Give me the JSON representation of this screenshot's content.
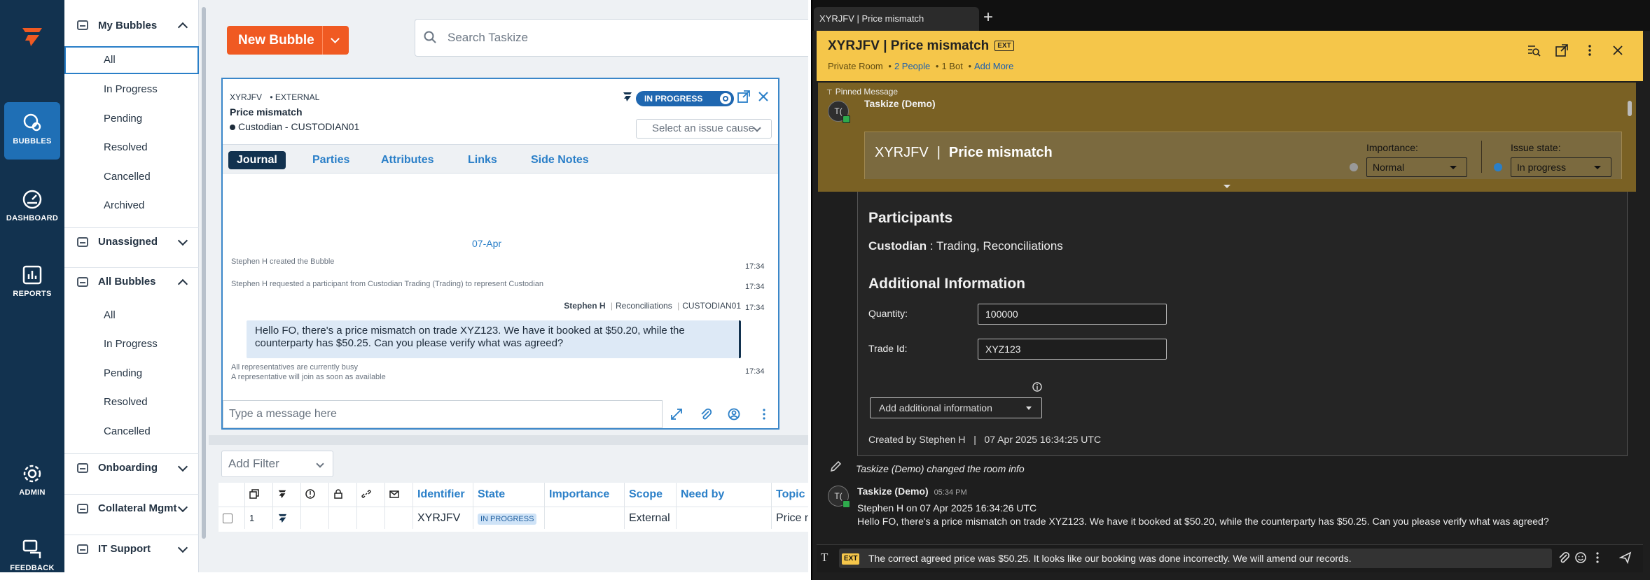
{
  "rail": {
    "items": [
      {
        "label": "BUBBLES"
      },
      {
        "label": "DASHBOARD"
      },
      {
        "label": "REPORTS"
      },
      {
        "label": "ADMIN"
      },
      {
        "label": "FEEDBACK"
      }
    ]
  },
  "sidebar": {
    "groups": [
      {
        "label": "My Bubbles",
        "items": [
          "All",
          "In Progress",
          "Pending",
          "Resolved",
          "Cancelled",
          "Archived"
        ]
      },
      {
        "label": "Unassigned"
      },
      {
        "label": "All Bubbles",
        "items": [
          "All",
          "In Progress",
          "Pending",
          "Resolved",
          "Cancelled"
        ]
      },
      {
        "label": "Onboarding"
      },
      {
        "label": "Collateral Mgmt"
      },
      {
        "label": "IT Support"
      }
    ]
  },
  "toolbar": {
    "new_bubble": "New Bubble",
    "search_placeholder": "Search Taskize"
  },
  "bubble": {
    "id": "XYRJFV",
    "scope": "• EXTERNAL",
    "title": "Price mismatch",
    "party": "Custodian - CUSTODIAN01",
    "status": "IN PROGRESS",
    "issue_cause_placeholder": "Select an issue cause",
    "tabs": [
      "Journal",
      "Parties",
      "Attributes",
      "Links",
      "Side Notes"
    ],
    "journal": {
      "date": "07-Apr",
      "events": [
        {
          "text": "Stephen H created the Bubble",
          "time": "17:34"
        },
        {
          "text": "Stephen H requested a participant from Custodian Trading (Trading) to represent Custodian",
          "time": "17:34"
        }
      ],
      "message_author": "Stephen H",
      "message_team": "Reconciliations",
      "message_org": "CUSTODIAN01",
      "message_time": "17:34",
      "message_text": "Hello FO, there's a price mismatch on trade XYZ123. We have it booked at $50.20, while the counterparty has $50.25. Can you please verify what was agreed?",
      "busy_line1": "All representatives are currently busy",
      "busy_line2": "A representative will join as soon as available",
      "busy_time": "17:34"
    },
    "composer_placeholder": "Type a message here"
  },
  "list": {
    "add_filter": "Add Filter",
    "columns": [
      "Identifier",
      "State",
      "Importance",
      "Scope",
      "Need by",
      "Topic"
    ],
    "rows": [
      {
        "num": "1",
        "identifier": "XYRJFV",
        "state": "IN PROGRESS",
        "importance": "",
        "scope": "External",
        "need_by": "",
        "topic": "Price m"
      }
    ]
  },
  "chat": {
    "tab_title": "XYRJFV | Price mismatch",
    "room_title": "XYRJFV | Price mismatch",
    "ext_badge": "EXT",
    "room_type": "Private Room",
    "people": "2 People",
    "bots": "1 Bot",
    "add_more": "Add More",
    "pinned_label": "Pinned Message",
    "pinned_author": "Taskize (Demo)",
    "card_id": "XYRJFV",
    "card_title": "Price mismatch",
    "importance_label": "Importance:",
    "importance_value": "Normal",
    "issue_state_label": "Issue state:",
    "issue_state_value": "In progress",
    "participants_heading": "Participants",
    "participants_role": "Custodian",
    "participants_value": ": Trading, Reconciliations",
    "additional_heading": "Additional Information",
    "quantity_label": "Quantity:",
    "quantity_value": "100000",
    "trade_id_label": "Trade Id:",
    "trade_id_value": "XYZ123",
    "add_info_placeholder": "Add additional information",
    "created_by": "Created by Stephen H   |   07 Apr 2025 16:34:25 UTC",
    "room_info_change": "Taskize (Demo) changed the room info",
    "msg_author": "Taskize (Demo)",
    "msg_time": "05:34 PM",
    "msg_line1": "Stephen H on 07 Apr 2025 16:34:26 UTC",
    "msg_line2": "Hello FO, there's a price mismatch on trade XYZ123. We have it booked at $50.20, while the counterparty has $50.25. Can you please verify what was agreed?",
    "avatar_initials": "T(",
    "composer_text": "The correct agreed price was $50.25. It looks like our booking was done incorrectly. We will amend our records."
  },
  "colors": {
    "rail": "#12324f",
    "accent": "#f05a22",
    "link": "#2a7fc8",
    "chat_header": "#f5c64a"
  }
}
